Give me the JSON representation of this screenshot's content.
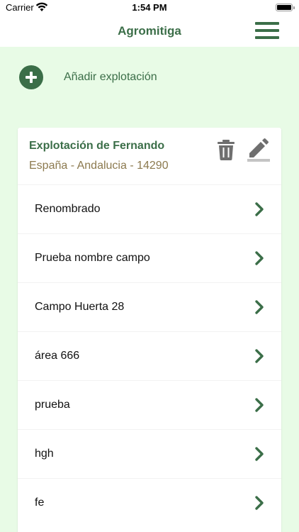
{
  "status_bar": {
    "carrier": "Carrier",
    "time": "1:54 PM"
  },
  "navbar": {
    "title": "Agromitiga",
    "menu_icon": "hamburger-menu-icon"
  },
  "add_farm": {
    "label": "Añadir explotación",
    "icon": "plus-circle-icon"
  },
  "farm": {
    "name": "Explotación de Fernando",
    "location": "España - Andalucia - 14290",
    "delete_icon": "trash-icon",
    "edit_icon": "pencil-icon",
    "fields": [
      {
        "label": "Renombrado"
      },
      {
        "label": "Prueba nombre campo"
      },
      {
        "label": "Campo Huerta 28"
      },
      {
        "label": "área 666"
      },
      {
        "label": "prueba"
      },
      {
        "label": "hgh"
      },
      {
        "label": "fe"
      }
    ]
  },
  "colors": {
    "primary": "#3b6e48",
    "background": "#e8fbe6",
    "location_text": "#8c7a4f",
    "icon_gray": "#6f6f6f"
  }
}
